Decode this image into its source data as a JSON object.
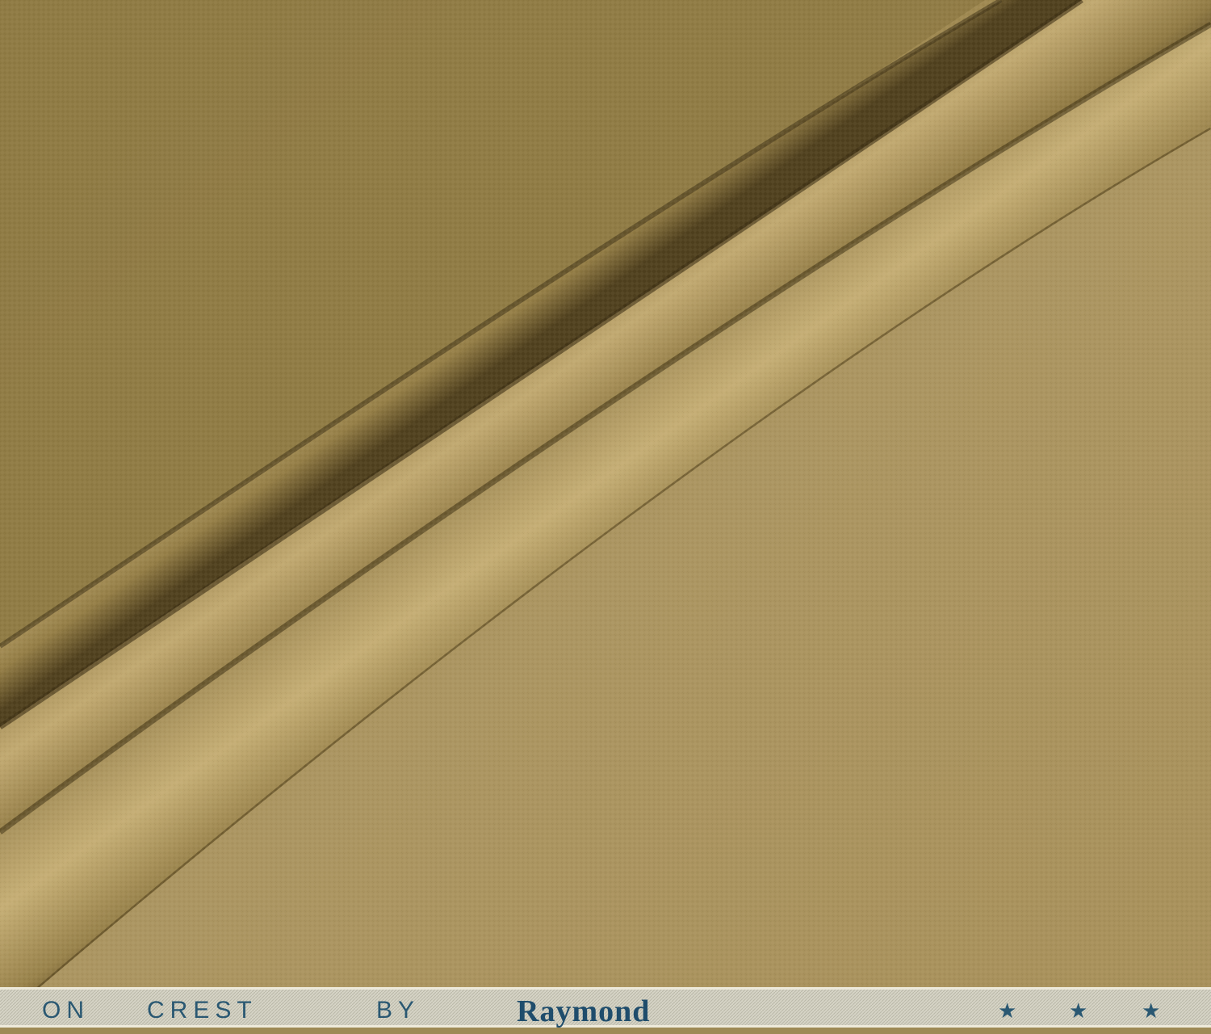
{
  "photo": {
    "subject": "fabric-swatch",
    "colors": {
      "fabric_base": "#a08a54",
      "fabric_light": "#b59e68",
      "fabric_shadow": "#5e4c27",
      "selvedge_band": "#d4d2c3",
      "selvedge_ink": "#2a5872"
    }
  },
  "selvedge": {
    "text_prefix": "ON",
    "text_collection": "CREST",
    "text_by": "BY",
    "brand": "Raymond",
    "stars": [
      "★",
      "★",
      "★"
    ]
  }
}
